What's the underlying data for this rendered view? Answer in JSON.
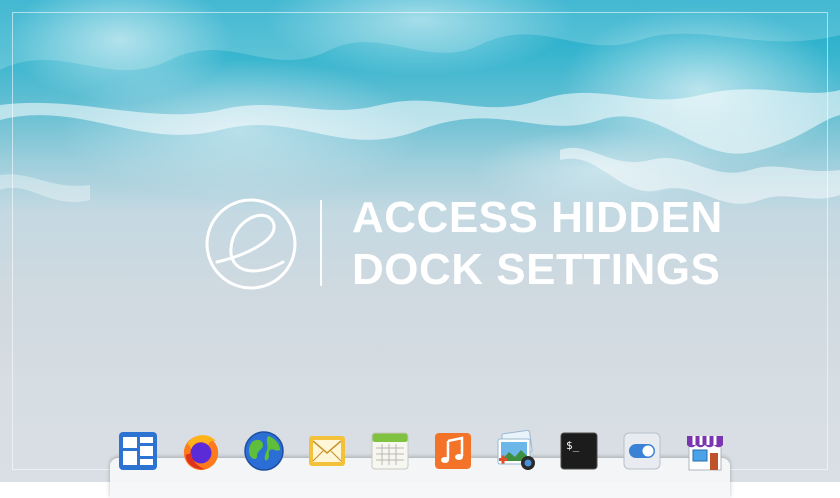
{
  "hero": {
    "title_line1": "ACCESS HIDDEN",
    "title_line2": "DOCK SETTINGS",
    "logo_icon": "elementary-os-logo-icon"
  },
  "dock": {
    "items": [
      {
        "name": "multitasking-view",
        "icon": "multitasking-icon"
      },
      {
        "name": "firefox",
        "icon": "firefox-icon"
      },
      {
        "name": "web-browser",
        "icon": "globe-icon"
      },
      {
        "name": "mail",
        "icon": "mail-icon"
      },
      {
        "name": "calendar",
        "icon": "calendar-icon"
      },
      {
        "name": "music",
        "icon": "music-icon"
      },
      {
        "name": "photos",
        "icon": "photos-icon"
      },
      {
        "name": "terminal",
        "icon": "terminal-icon",
        "text": "$_"
      },
      {
        "name": "system-settings",
        "icon": "toggle-switch-icon"
      },
      {
        "name": "appcenter",
        "icon": "appcenter-store-icon"
      }
    ]
  },
  "colors": {
    "sea": "#1aa9c8",
    "sand": "#d9dfe4",
    "title": "#ffffff"
  }
}
